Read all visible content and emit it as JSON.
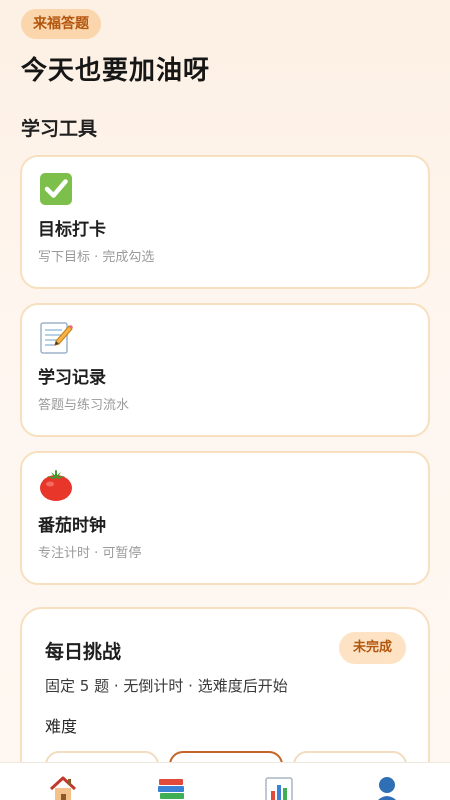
{
  "app": {
    "badge": "来福答题"
  },
  "greeting": "今天也要加油呀",
  "tools_section": {
    "title": "学习工具",
    "cards": [
      {
        "icon": "check-mark-icon",
        "title": "目标打卡",
        "desc": "写下目标 · 完成勾选"
      },
      {
        "icon": "memo-icon",
        "title": "学习记录",
        "desc": "答题与练习流水"
      },
      {
        "icon": "tomato-icon",
        "title": "番茄时钟",
        "desc": "专注计时 · 可暂停"
      }
    ]
  },
  "challenge": {
    "title": "每日挑战",
    "status": "未完成",
    "desc": "固定 5 题 · 无倒计时 · 选难度后开始",
    "difficulty_label": "难度"
  },
  "bottom_nav": {
    "items": [
      {
        "icon": "house-icon"
      },
      {
        "icon": "books-icon"
      },
      {
        "icon": "bar-chart-icon"
      },
      {
        "icon": "user-icon"
      }
    ]
  },
  "colors": {
    "accent": "#b2560e",
    "badge_bg": "#fbd6ad",
    "card_border": "#f7dfbf",
    "selected_border": "#c4652a"
  }
}
